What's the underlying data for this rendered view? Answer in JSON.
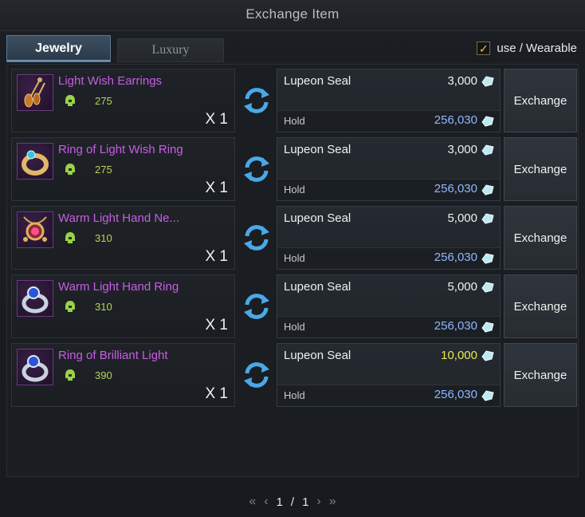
{
  "window": {
    "title": "Exchange Item"
  },
  "tabs": [
    {
      "label": "Jewelry",
      "active": true
    },
    {
      "label": "Luxury",
      "active": false
    }
  ],
  "filter": {
    "label": "use / Wearable",
    "checked": true
  },
  "rows": [
    {
      "item": {
        "name": "Light Wish Earrings",
        "level": "275",
        "quantity": "X 1",
        "icon": "earrings-icon"
      },
      "cost": {
        "currency": "Lupeon Seal",
        "amount": "3,000",
        "hold_label": "Hold",
        "hold_amount": "256,030"
      },
      "button": "Exchange"
    },
    {
      "item": {
        "name": "Ring of Light Wish Ring",
        "level": "275",
        "quantity": "X 1",
        "icon": "ring-gold-icon"
      },
      "cost": {
        "currency": "Lupeon Seal",
        "amount": "3,000",
        "hold_label": "Hold",
        "hold_amount": "256,030"
      },
      "button": "Exchange"
    },
    {
      "item": {
        "name": "Warm Light Hand Ne...",
        "level": "310",
        "quantity": "X 1",
        "icon": "necklace-icon"
      },
      "cost": {
        "currency": "Lupeon Seal",
        "amount": "5,000",
        "hold_label": "Hold",
        "hold_amount": "256,030"
      },
      "button": "Exchange"
    },
    {
      "item": {
        "name": "Warm Light Hand Ring",
        "level": "310",
        "quantity": "X 1",
        "icon": "ring-sapphire-icon"
      },
      "cost": {
        "currency": "Lupeon Seal",
        "amount": "5,000",
        "hold_label": "Hold",
        "hold_amount": "256,030"
      },
      "button": "Exchange"
    },
    {
      "item": {
        "name": "Ring of Brilliant Light",
        "level": "390",
        "quantity": "X 1",
        "icon": "ring-sapphire-icon"
      },
      "cost": {
        "currency": "Lupeon Seal",
        "amount": "10,000",
        "amount_highlight": true,
        "hold_label": "Hold",
        "hold_amount": "256,030"
      },
      "button": "Exchange"
    }
  ],
  "pagination": {
    "current": "1",
    "separator": "/",
    "total": "1"
  },
  "colors": {
    "item_name": "#c95ce6",
    "level": "#b9d25a",
    "hold_amount": "#8fb6ff",
    "highlight_amount": "#e8e85a"
  }
}
